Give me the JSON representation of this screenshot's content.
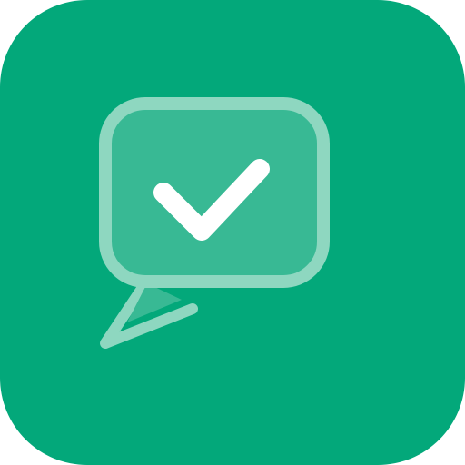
{
  "icon": {
    "semantic": "chat-bubble-checkmark-icon",
    "colors": {
      "background": "#03A87A",
      "bubble_fill": "#38B994",
      "bubble_outline": "#8ED7C0",
      "checkmark": "#FFFFFF"
    }
  }
}
